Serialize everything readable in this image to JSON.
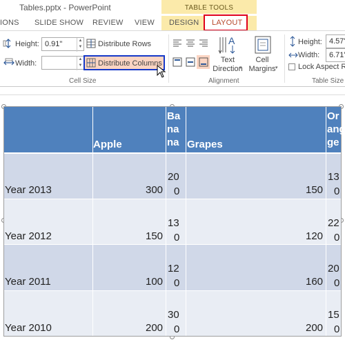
{
  "window": {
    "title": "Tables.pptx - PowerPoint"
  },
  "context_tab_group": "TABLE TOOLS",
  "tabs": [
    {
      "label": "IONS"
    },
    {
      "label": "SLIDE SHOW"
    },
    {
      "label": "REVIEW"
    },
    {
      "label": "VIEW"
    },
    {
      "label": "DESIGN"
    },
    {
      "label": "LAYOUT"
    }
  ],
  "cell_size": {
    "height_label": "Height:",
    "height_value": "0.91\"",
    "width_label": "Width:",
    "width_value": "",
    "distribute_rows": "Distribute Rows",
    "distribute_columns": "Distribute Columns",
    "group_label": "Cell Size"
  },
  "alignment": {
    "text_direction_label": "Text Direction",
    "cell_margins_label": "Cell Margins",
    "group_label": "Alignment"
  },
  "table_size": {
    "height_label": "Height:",
    "height_value": "4.57\"",
    "width_label": "Width:",
    "width_value": "6.71\"",
    "lock_aspect": "Lock Aspect Ra",
    "group_label": "Table Size"
  },
  "table": {
    "header": [
      "",
      "Apple",
      "Banana",
      "Grapes",
      "Orange"
    ],
    "header_wrapped": {
      "banana": [
        "Ba",
        "na",
        "na"
      ],
      "orange": [
        "Or",
        "ang",
        "ge"
      ]
    },
    "rows": [
      {
        "year": "Year 2013",
        "apple": "300",
        "banana": [
          "20",
          "0"
        ],
        "grapes": "150",
        "orange": [
          "13",
          "0"
        ]
      },
      {
        "year": "Year 2012",
        "apple": "150",
        "banana": [
          "13",
          "0"
        ],
        "grapes": "120",
        "orange": [
          "22",
          "0"
        ]
      },
      {
        "year": "Year 2011",
        "apple": "100",
        "banana": [
          "12",
          "0"
        ],
        "grapes": "160",
        "orange": [
          "20",
          "0"
        ]
      },
      {
        "year": "Year 2010",
        "apple": "200",
        "banana": [
          "30",
          "0"
        ],
        "grapes": "200",
        "orange": [
          "15",
          "0"
        ]
      }
    ]
  },
  "colors": {
    "header_fill": "#4f81bd",
    "row_dark": "#d0d8e8",
    "row_light": "#e9edf4",
    "table_tools": "#fbeaaa",
    "layout_highlight": "#e0001a",
    "distribute_highlight": "#1538c8"
  }
}
